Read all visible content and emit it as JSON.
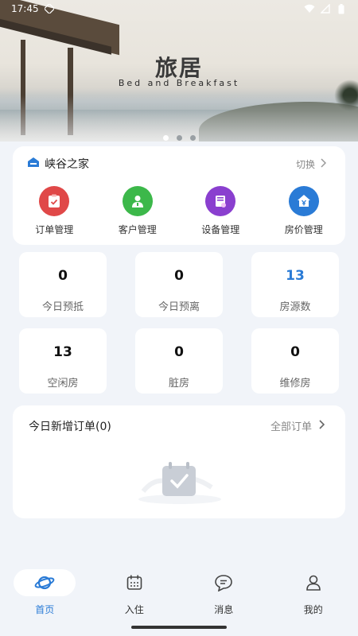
{
  "status_bar": {
    "time": "17:45"
  },
  "banner": {
    "title": "旅居",
    "subtitle": "Bed and Breakfast",
    "slides": 3,
    "active_slide": 0
  },
  "hotel": {
    "name": "峡谷之家",
    "switch_label": "切换",
    "menu": [
      {
        "label": "订单管理",
        "icon": "order-clipboard-icon",
        "color": "#e04848"
      },
      {
        "label": "客户管理",
        "icon": "customer-person-icon",
        "color": "#3cb84a"
      },
      {
        "label": "设备管理",
        "icon": "device-icon",
        "color": "#8a3fcf"
      },
      {
        "label": "房价管理",
        "icon": "house-price-icon",
        "color": "#2a7bd6"
      }
    ]
  },
  "stats": [
    {
      "value": "0",
      "label": "今日预抵"
    },
    {
      "value": "0",
      "label": "今日预离"
    },
    {
      "value": "13",
      "label": "房源数"
    },
    {
      "value": "13",
      "label": "空闲房"
    },
    {
      "value": "0",
      "label": "脏房"
    },
    {
      "value": "0",
      "label": "维修房"
    }
  ],
  "orders": {
    "title": "今日新增订单(0)",
    "all_label": "全部订单"
  },
  "bottom_nav": [
    {
      "label": "首页",
      "icon": "planet-home-icon",
      "active": true
    },
    {
      "label": "入住",
      "icon": "calendar-icon",
      "active": false
    },
    {
      "label": "消息",
      "icon": "message-bubble-icon",
      "active": false
    },
    {
      "label": "我的",
      "icon": "user-profile-icon",
      "active": false
    }
  ],
  "colors": {
    "accent": "#2a7bd6",
    "background": "#f1f4f9"
  }
}
